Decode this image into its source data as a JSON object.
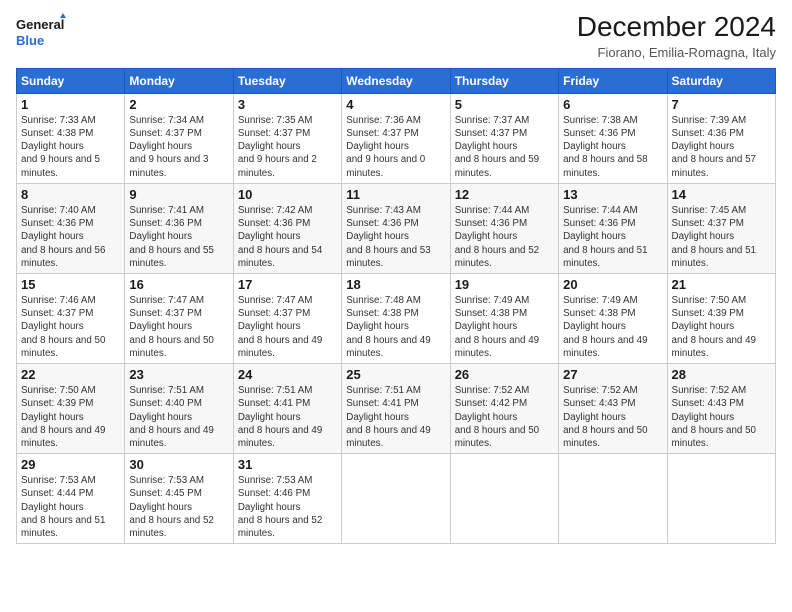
{
  "logo": {
    "text_general": "General",
    "text_blue": "Blue"
  },
  "header": {
    "title": "December 2024",
    "subtitle": "Fiorano, Emilia-Romagna, Italy"
  },
  "days_of_week": [
    "Sunday",
    "Monday",
    "Tuesday",
    "Wednesday",
    "Thursday",
    "Friday",
    "Saturday"
  ],
  "weeks": [
    [
      {
        "day": 1,
        "sunrise": "7:33 AM",
        "sunset": "4:38 PM",
        "daylight": "9 hours and 5 minutes."
      },
      {
        "day": 2,
        "sunrise": "7:34 AM",
        "sunset": "4:37 PM",
        "daylight": "9 hours and 3 minutes."
      },
      {
        "day": 3,
        "sunrise": "7:35 AM",
        "sunset": "4:37 PM",
        "daylight": "9 hours and 2 minutes."
      },
      {
        "day": 4,
        "sunrise": "7:36 AM",
        "sunset": "4:37 PM",
        "daylight": "9 hours and 0 minutes."
      },
      {
        "day": 5,
        "sunrise": "7:37 AM",
        "sunset": "4:37 PM",
        "daylight": "8 hours and 59 minutes."
      },
      {
        "day": 6,
        "sunrise": "7:38 AM",
        "sunset": "4:36 PM",
        "daylight": "8 hours and 58 minutes."
      },
      {
        "day": 7,
        "sunrise": "7:39 AM",
        "sunset": "4:36 PM",
        "daylight": "8 hours and 57 minutes."
      }
    ],
    [
      {
        "day": 8,
        "sunrise": "7:40 AM",
        "sunset": "4:36 PM",
        "daylight": "8 hours and 56 minutes."
      },
      {
        "day": 9,
        "sunrise": "7:41 AM",
        "sunset": "4:36 PM",
        "daylight": "8 hours and 55 minutes."
      },
      {
        "day": 10,
        "sunrise": "7:42 AM",
        "sunset": "4:36 PM",
        "daylight": "8 hours and 54 minutes."
      },
      {
        "day": 11,
        "sunrise": "7:43 AM",
        "sunset": "4:36 PM",
        "daylight": "8 hours and 53 minutes."
      },
      {
        "day": 12,
        "sunrise": "7:44 AM",
        "sunset": "4:36 PM",
        "daylight": "8 hours and 52 minutes."
      },
      {
        "day": 13,
        "sunrise": "7:44 AM",
        "sunset": "4:36 PM",
        "daylight": "8 hours and 51 minutes."
      },
      {
        "day": 14,
        "sunrise": "7:45 AM",
        "sunset": "4:37 PM",
        "daylight": "8 hours and 51 minutes."
      }
    ],
    [
      {
        "day": 15,
        "sunrise": "7:46 AM",
        "sunset": "4:37 PM",
        "daylight": "8 hours and 50 minutes."
      },
      {
        "day": 16,
        "sunrise": "7:47 AM",
        "sunset": "4:37 PM",
        "daylight": "8 hours and 50 minutes."
      },
      {
        "day": 17,
        "sunrise": "7:47 AM",
        "sunset": "4:37 PM",
        "daylight": "8 hours and 49 minutes."
      },
      {
        "day": 18,
        "sunrise": "7:48 AM",
        "sunset": "4:38 PM",
        "daylight": "8 hours and 49 minutes."
      },
      {
        "day": 19,
        "sunrise": "7:49 AM",
        "sunset": "4:38 PM",
        "daylight": "8 hours and 49 minutes."
      },
      {
        "day": 20,
        "sunrise": "7:49 AM",
        "sunset": "4:38 PM",
        "daylight": "8 hours and 49 minutes."
      },
      {
        "day": 21,
        "sunrise": "7:50 AM",
        "sunset": "4:39 PM",
        "daylight": "8 hours and 49 minutes."
      }
    ],
    [
      {
        "day": 22,
        "sunrise": "7:50 AM",
        "sunset": "4:39 PM",
        "daylight": "8 hours and 49 minutes."
      },
      {
        "day": 23,
        "sunrise": "7:51 AM",
        "sunset": "4:40 PM",
        "daylight": "8 hours and 49 minutes."
      },
      {
        "day": 24,
        "sunrise": "7:51 AM",
        "sunset": "4:41 PM",
        "daylight": "8 hours and 49 minutes."
      },
      {
        "day": 25,
        "sunrise": "7:51 AM",
        "sunset": "4:41 PM",
        "daylight": "8 hours and 49 minutes."
      },
      {
        "day": 26,
        "sunrise": "7:52 AM",
        "sunset": "4:42 PM",
        "daylight": "8 hours and 50 minutes."
      },
      {
        "day": 27,
        "sunrise": "7:52 AM",
        "sunset": "4:43 PM",
        "daylight": "8 hours and 50 minutes."
      },
      {
        "day": 28,
        "sunrise": "7:52 AM",
        "sunset": "4:43 PM",
        "daylight": "8 hours and 50 minutes."
      }
    ],
    [
      {
        "day": 29,
        "sunrise": "7:53 AM",
        "sunset": "4:44 PM",
        "daylight": "8 hours and 51 minutes."
      },
      {
        "day": 30,
        "sunrise": "7:53 AM",
        "sunset": "4:45 PM",
        "daylight": "8 hours and 52 minutes."
      },
      {
        "day": 31,
        "sunrise": "7:53 AM",
        "sunset": "4:46 PM",
        "daylight": "8 hours and 52 minutes."
      },
      null,
      null,
      null,
      null
    ]
  ]
}
